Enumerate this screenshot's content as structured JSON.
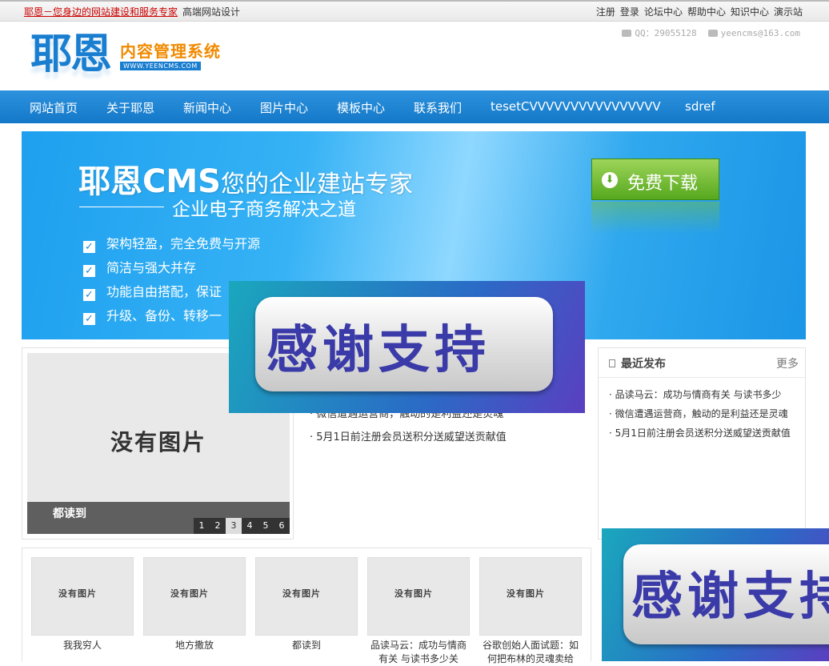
{
  "topbar": {
    "slogan": "耶恩－您身边的网站建设和服务专家",
    "sub": "高端网站设计",
    "links": [
      "注册",
      "登录",
      "论坛中心",
      "帮助中心",
      "知识中心",
      "演示站"
    ]
  },
  "header": {
    "logo_big": "耶恩",
    "logo_sub": "内容管理系统",
    "logo_url": "WWW.YEENCMS.COM",
    "qq": "QQ：29055128",
    "email": "yeencms@163.com"
  },
  "nav": {
    "items": [
      "网站首页",
      "关于耶恩",
      "新闻中心",
      "图片中心",
      "模板中心",
      "联系我们",
      "tesetCVVVVVVVVVVVVVVVV",
      "sdref"
    ]
  },
  "banner": {
    "title_brand": "耶恩CMS",
    "title_rest": "您的企业建站专家",
    "subtitle": "企业电子商务解决之道",
    "features": [
      "架构轻盈，完全免费与开源",
      "简洁与强大并存",
      "功能自由搭配，保证",
      "升级、备份、转移一"
    ],
    "download_label": "免费下载"
  },
  "slideshow": {
    "no_image": "没有图片",
    "caption": "都读到",
    "pages": [
      "1",
      "2",
      "3",
      "4",
      "5",
      "6"
    ],
    "active_page": "3"
  },
  "news_middle": {
    "items": [
      "微信遭遇运营商，触动的是利益还是灵魂",
      "5月1日前注册会员送积分送威望送贡献值"
    ]
  },
  "latest": {
    "title": "最近发布",
    "more": "更多",
    "items": [
      "品读马云：成功与情商有关 与读书多少",
      "微信遭遇运营商，触动的是利益还是灵魂",
      "5月1日前注册会员送积分送威望送贡献值"
    ]
  },
  "overlay": {
    "text": "感谢支持"
  },
  "products": [
    {
      "label": "我我穷人",
      "no_image": "没有图片"
    },
    {
      "label": "地方撒放",
      "no_image": "没有图片"
    },
    {
      "label": "都读到",
      "no_image": "没有图片"
    },
    {
      "label": "品读马云：成功与情商有关 与读书多少关",
      "no_image": "没有图片"
    },
    {
      "label": "谷歌创始人面试题：如何把布林的灵魂卖给",
      "no_image": "没有图片"
    }
  ],
  "colors": {
    "nav_blue": "#1a84d4",
    "banner_blue": "#2aa9f0",
    "download_green": "#6bb82a",
    "overlay_text": "#3a3aa8",
    "slogan_red": "#cc0000"
  }
}
